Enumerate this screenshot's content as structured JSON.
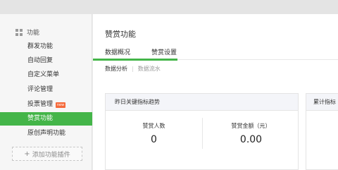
{
  "sidebar": {
    "header": "功能",
    "header_icon": "grid-icon",
    "items": [
      {
        "label": "群发功能"
      },
      {
        "label": "自动回复"
      },
      {
        "label": "自定义菜单"
      },
      {
        "label": "评论管理"
      },
      {
        "label": "投票管理",
        "badge": "new"
      },
      {
        "label": "赞赏功能",
        "active": true
      },
      {
        "label": "原创声明功能"
      }
    ],
    "add_plugin": "添加功能插件"
  },
  "main": {
    "title": "赞赏功能",
    "tabs": [
      "数据概况",
      "赞赏设置"
    ],
    "subtabs": [
      "数据分析",
      "数据流水"
    ],
    "card1": {
      "title": "昨日关键指标趋势",
      "stats": [
        {
          "label": "赞赏人数",
          "value": "0"
        },
        {
          "label": "赞赏金额（元）",
          "value": "0.00"
        }
      ]
    },
    "card2": {
      "title": "累计指标"
    }
  },
  "colors": {
    "accent": "#44b549",
    "badge": "#f56a3b"
  }
}
